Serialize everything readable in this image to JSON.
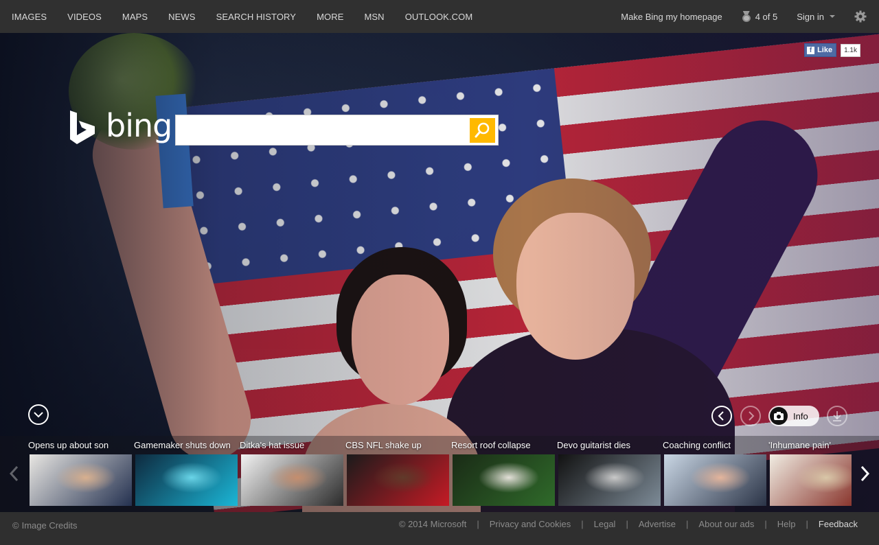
{
  "nav": {
    "items": [
      "IMAGES",
      "VIDEOS",
      "MAPS",
      "NEWS",
      "SEARCH HISTORY",
      "MORE",
      "MSN",
      "OUTLOOK.COM"
    ],
    "make_homepage": "Make Bing my homepage",
    "rewards": "4 of 5",
    "sign_in": "Sign in"
  },
  "hero": {
    "logo_text": "bing",
    "search": {
      "value": "",
      "placeholder": ""
    },
    "facebook": {
      "like_label": "Like",
      "count": "1.1k"
    },
    "info_label": "Info"
  },
  "news": {
    "items": [
      {
        "caption": "Opens up about son",
        "thumb": [
          "#e8e6e2",
          "#243150",
          "#d8b08f"
        ]
      },
      {
        "caption": "Gamemaker shuts down",
        "thumb": [
          "#0e2a3f",
          "#1bb6d6",
          "#6ad5e8"
        ]
      },
      {
        "caption": "Ditka's hat issue",
        "thumb": [
          "#f2f2f2",
          "#2b2b2b",
          "#c58e6e"
        ]
      },
      {
        "caption": "CBS NFL shake up",
        "thumb": [
          "#1b1b1b",
          "#c51b25",
          "#603a2a"
        ]
      },
      {
        "caption": "Resort roof collapse",
        "thumb": [
          "#1a2b16",
          "#2f6a2a",
          "#e3e0d8"
        ]
      },
      {
        "caption": "Devo guitarist dies",
        "thumb": [
          "#121212",
          "#7d8b97",
          "#c9c9c9"
        ]
      },
      {
        "caption": "Coaching conflict",
        "thumb": [
          "#c9d6e4",
          "#2b3447",
          "#e4b59c"
        ]
      },
      {
        "caption": "'Inhumane pain'",
        "thumb": [
          "#f0ece2",
          "#7a1a12",
          "#d9c7a8"
        ]
      }
    ]
  },
  "footer": {
    "credits": "Image Credits",
    "copyright": "© 2014 Microsoft",
    "links": [
      "Privacy and Cookies",
      "Legal",
      "Advertise",
      "About our ads",
      "Help"
    ],
    "feedback": "Feedback"
  },
  "colors": {
    "topbar": "#303030",
    "search_button": "#ffb900",
    "flag_red": "#c22538",
    "flag_blue": "#2f3e83"
  },
  "icons": [
    "bing-logo-icon",
    "search-icon",
    "rewards-medal-icon",
    "gear-icon",
    "facebook-icon",
    "chevron-down-icon",
    "arrow-left-icon",
    "arrow-right-icon",
    "camera-icon",
    "download-icon",
    "copyright-icon"
  ]
}
